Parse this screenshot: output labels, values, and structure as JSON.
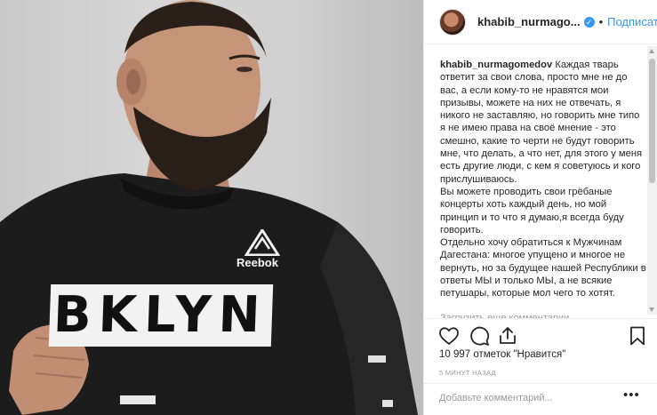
{
  "photo": {
    "brand_text": "Reebok",
    "shirt_text": "BKLYN"
  },
  "header": {
    "username": "khabib_nurmago...",
    "separator": "•",
    "follow_label": "Подписаться",
    "verified_glyph": "✓"
  },
  "caption": {
    "username": "khabib_nurmagomedov",
    "paragraphs": [
      "Каждая тварь ответит за свои слова, просто мне не до вас, а если кому-то не нравятся мои призывы, можете на них не отвечать, я никого не заставляю, но говорить мне типо я не имею права на своё мнение - это смешно, какие то черти не будут говорить мне, что делать, а что нет, для этого у меня есть другие люди, с кем я советуюсь и кого прислушиваюсь.",
      "Вы можете проводить свои грёбаные концерты хоть каждый день, но мой принцип и то что я думаю,я всегда буду говорить.",
      "Отдельно хочу обратиться к Мужчинам Дагестана: многое упущено и многое не вернуть, но за будущее нашей Республики в ответы МЫ и только МЫ, а не всякие петушары, которые мол чего то хотят."
    ],
    "load_more": "Загрузить еще комментарии"
  },
  "actions": {
    "icons": [
      "heart-icon",
      "comment-icon",
      "share-icon",
      "bookmark-icon"
    ]
  },
  "likes_text": "10 997 отметок \"Нравится\"",
  "time_text": "5 МИНУТ НАЗАД",
  "comment": {
    "placeholder": "Добавьте комментарий...",
    "more_glyph": "•••"
  },
  "colors": {
    "link_blue": "#3897f0",
    "text": "#262626",
    "muted": "#999999",
    "divider": "#efefef"
  }
}
